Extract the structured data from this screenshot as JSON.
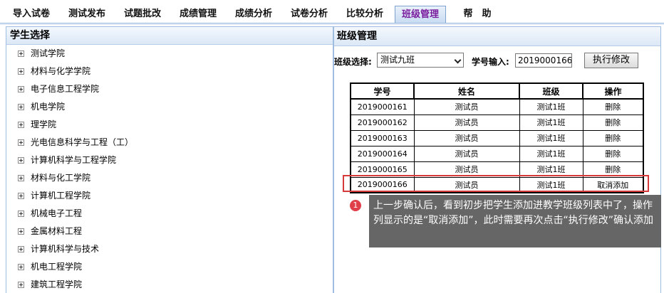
{
  "nav": {
    "tabs": [
      {
        "label": "导入试卷"
      },
      {
        "label": "测试发布"
      },
      {
        "label": "试题批改"
      },
      {
        "label": "成绩管理"
      },
      {
        "label": "成绩分析"
      },
      {
        "label": "试卷分析"
      },
      {
        "label": "比较分析"
      },
      {
        "label": "班级管理",
        "active": true
      },
      {
        "label": "帮　助"
      }
    ],
    "active_color": "#7a1d9e"
  },
  "left_panel": {
    "title": "学生选择",
    "items": [
      {
        "label": "测试学院"
      },
      {
        "label": "材料与化学学院"
      },
      {
        "label": "电子信息工程学院"
      },
      {
        "label": "机电学院"
      },
      {
        "label": "理学院"
      },
      {
        "label": "光电信息科学与工程（工）"
      },
      {
        "label": "计算机科学与工程学院"
      },
      {
        "label": "材料与化工学院"
      },
      {
        "label": "计算机工程学院"
      },
      {
        "label": "机械电子工程"
      },
      {
        "label": "金属材料工程"
      },
      {
        "label": "计算机科学与技术"
      },
      {
        "label": "机电工程学院"
      },
      {
        "label": "建筑工程学院"
      }
    ],
    "expand_icon": "plus-box-icon"
  },
  "right_panel": {
    "title": "班级管理",
    "class_select_label": "班级选择:",
    "class_select_value": "测试九班",
    "student_id_label": "学号输入:",
    "student_id_value": "2019000166",
    "exec_button": "执行修改",
    "table": {
      "headers": [
        "学号",
        "姓名",
        "班级",
        "操作"
      ],
      "rows": [
        [
          "2019000161",
          "测试员",
          "测试1班",
          "删除"
        ],
        [
          "2019000162",
          "测试员",
          "测试1班",
          "删除"
        ],
        [
          "2019000163",
          "测试员",
          "测试1班",
          "删除"
        ],
        [
          "2019000164",
          "测试员",
          "测试1班",
          "删除"
        ],
        [
          "2019000165",
          "测试员",
          "测试1班",
          "删除"
        ],
        [
          "2019000166",
          "测试员",
          "测试1班",
          "取消添加"
        ]
      ]
    }
  },
  "annotation": {
    "badge": "1",
    "text": "上一步确认后，看到初步把学生添加进教学班级列表中了，操作列显示的是“取消添加”，此时需要再次点击“执行修改”确认添加",
    "highlight_color": "#d63a3a",
    "badge_color": "#e0404a"
  }
}
